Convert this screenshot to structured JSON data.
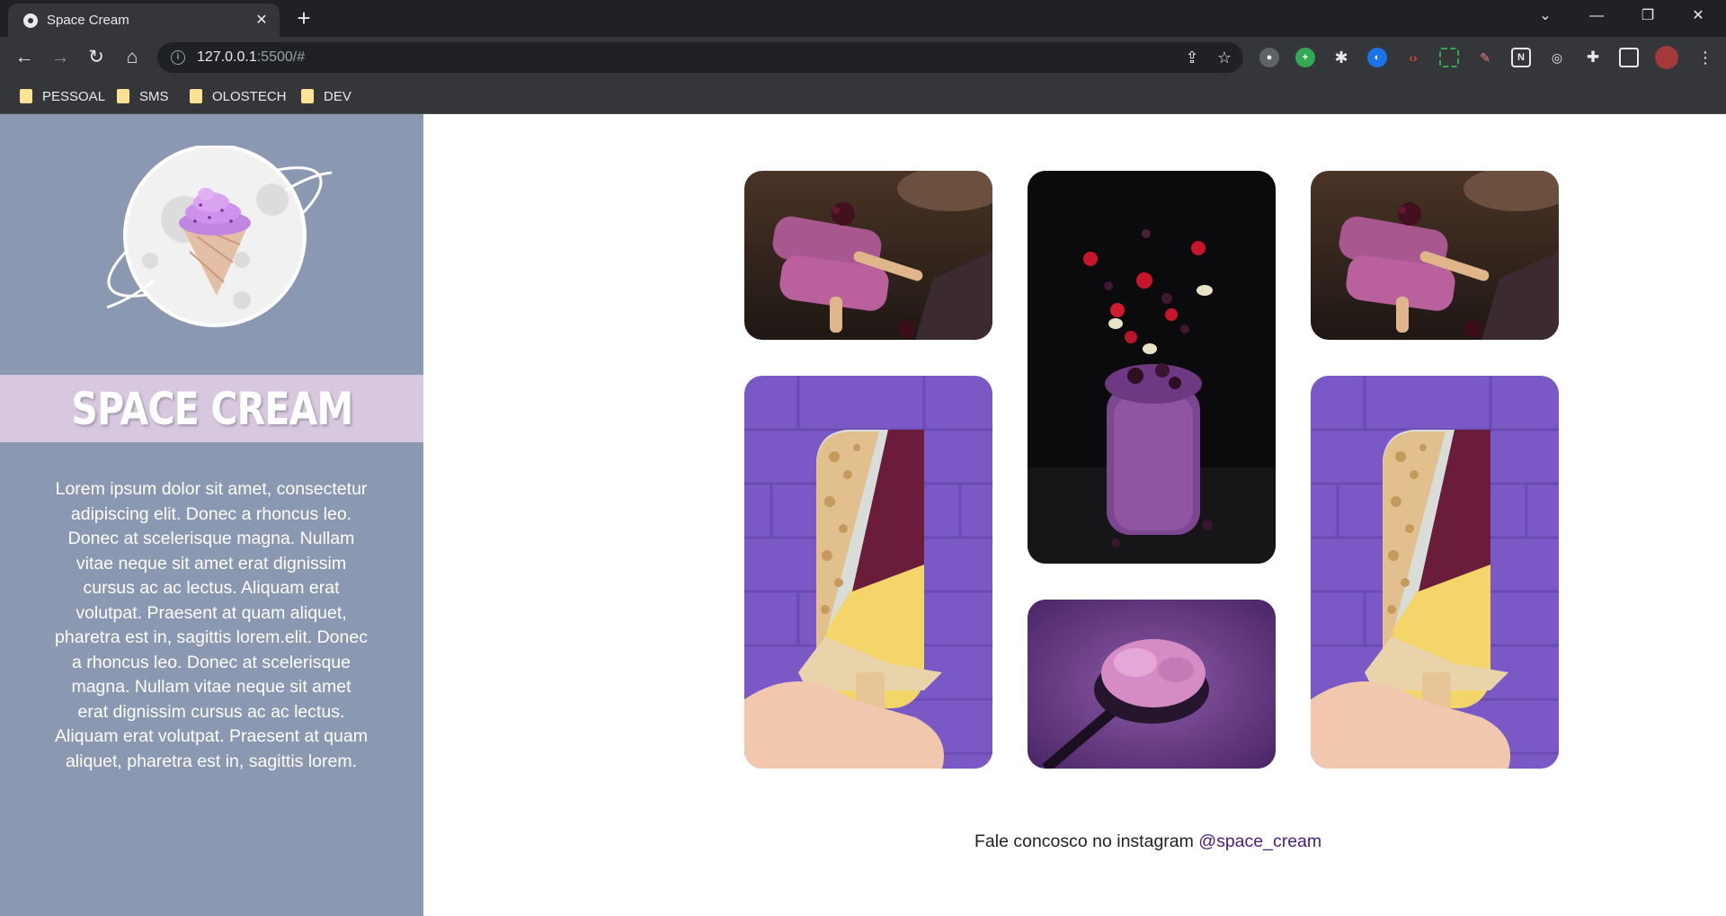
{
  "browser": {
    "tab_title": "Space Cream",
    "url_host": "127.0.0.1",
    "url_path": ":5500/#",
    "bookmarks": [
      "PESSOAL",
      "SMS",
      "OLOSTECH",
      "DEV"
    ]
  },
  "sidebar": {
    "brand": "SPACE CREAM",
    "description": "Lorem ipsum dolor sit amet, consectetur adipiscing elit. Donec a rhoncus leo. Donec at scelerisque magna. Nullam vitae neque sit amet erat dignissim cursus ac ac lectus. Aliquam erat volutpat. Praesent at quam aliquet, pharetra est in, sagittis lorem.elit. Donec a rhoncus leo. Donec at scelerisque magna. Nullam vitae neque sit amet erat dignissim cursus ac ac lectus. Aliquam erat volutpat. Praesent at quam aliquet, pharetra est in, sagittis lorem."
  },
  "footer": {
    "text": "Fale concosco no instagram",
    "instagram_handle": "@space_cream"
  },
  "colors": {
    "sidebar_bg": "#8b98b1",
    "brand_band": "#d7c8df",
    "link": "#4a1d80"
  }
}
